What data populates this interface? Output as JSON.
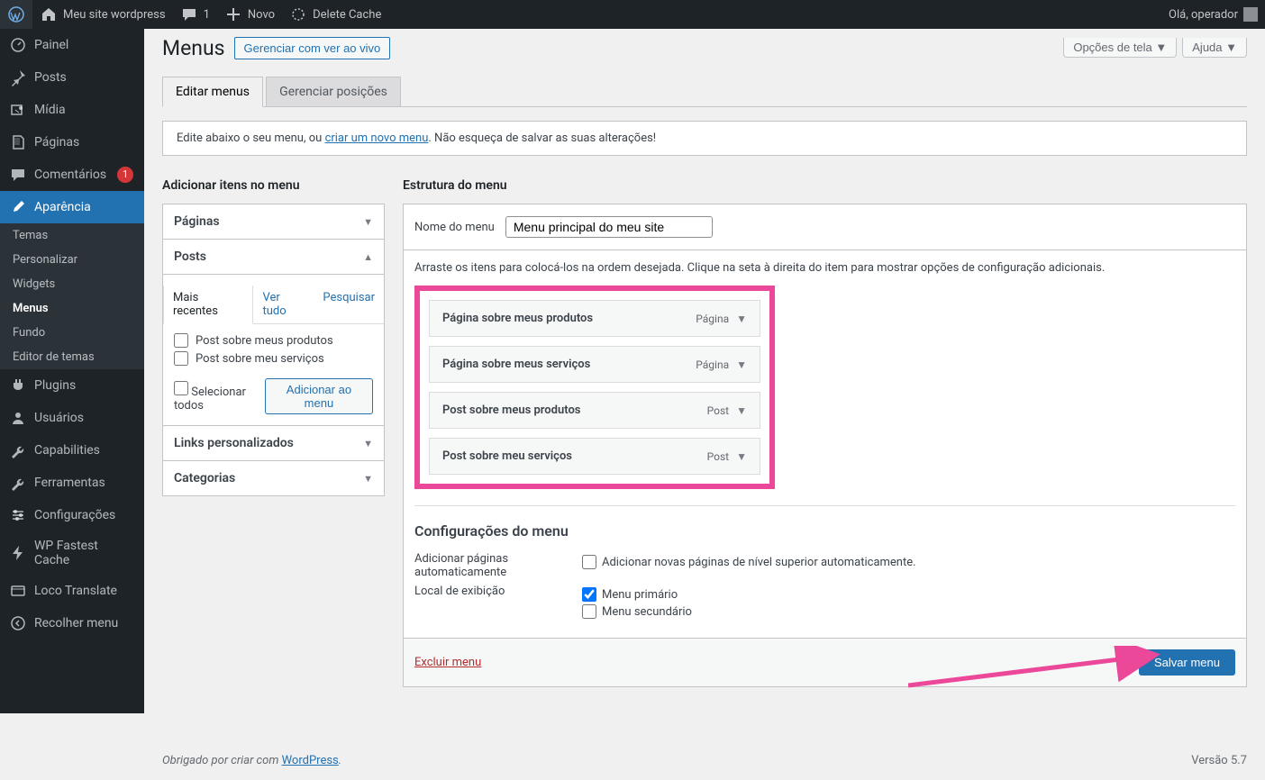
{
  "adminbar": {
    "site_title": "Meu site wordpress",
    "comments_count": "1",
    "new_label": "Novo",
    "delete_cache": "Delete Cache",
    "greeting": "Olá, operador"
  },
  "sidebar": {
    "items": [
      {
        "label": "Painel",
        "icon": "dashboard"
      },
      {
        "label": "Posts",
        "icon": "pin"
      },
      {
        "label": "Mídia",
        "icon": "media"
      },
      {
        "label": "Páginas",
        "icon": "pages"
      },
      {
        "label": "Comentários",
        "icon": "comment",
        "badge": "1"
      },
      {
        "label": "Aparência",
        "icon": "brush",
        "current": true,
        "submenu": [
          "Temas",
          "Personalizar",
          "Widgets",
          "Menus",
          "Fundo",
          "Editor de temas"
        ],
        "sub_current": "Menus"
      },
      {
        "label": "Plugins",
        "icon": "plugin"
      },
      {
        "label": "Usuários",
        "icon": "users"
      },
      {
        "label": "Capabilities",
        "icon": "wrench"
      },
      {
        "label": "Ferramentas",
        "icon": "wrench"
      },
      {
        "label": "Configurações",
        "icon": "sliders"
      },
      {
        "label": "WP Fastest Cache",
        "icon": "bolt"
      },
      {
        "label": "Loco Translate",
        "icon": "globe"
      },
      {
        "label": "Recolher menu",
        "icon": "collapse"
      }
    ]
  },
  "screen_opts": "Opções de tela",
  "help": "Ajuda",
  "page": {
    "title": "Menus",
    "live_action": "Gerenciar com ver ao vivo",
    "tabs": {
      "edit": "Editar menus",
      "locations": "Gerenciar posições"
    },
    "notice_pre": "Edite abaixo o seu menu, ou ",
    "notice_link": "criar um novo menu",
    "notice_post": ". Não esqueça de salvar as suas alterações!"
  },
  "add_box": {
    "heading": "Adicionar itens no menu",
    "sections": {
      "paginas": "Páginas",
      "posts": "Posts",
      "links": "Links personalizados",
      "categorias": "Categorias"
    },
    "subtabs": {
      "recent": "Mais recentes",
      "all": "Ver tudo",
      "search": "Pesquisar"
    },
    "post_items": [
      "Post sobre meus produtos",
      "Post sobre meu serviços"
    ],
    "select_all": "Selecionar todos",
    "add_button": "Adicionar ao menu"
  },
  "structure": {
    "heading": "Estrutura do menu",
    "name_label": "Nome do menu",
    "name_value": "Menu principal do meu site",
    "hint": "Arraste os itens para colocá-los na ordem desejada. Clique na seta à direita do item para mostrar opções de configuração adicionais.",
    "items": [
      {
        "title": "Página sobre meus produtos",
        "type": "Página"
      },
      {
        "title": "Página sobre meus serviços",
        "type": "Página"
      },
      {
        "title": "Post sobre meus produtos",
        "type": "Post"
      },
      {
        "title": "Post sobre meu serviços",
        "type": "Post"
      }
    ],
    "settings_heading": "Configurações do menu",
    "auto_add_label": "Adicionar páginas automaticamente",
    "auto_add_cb": "Adicionar novas páginas de nível superior automaticamente.",
    "location_label": "Local de exibição",
    "locations": [
      "Menu primário",
      "Menu secundário"
    ],
    "delete": "Excluir menu",
    "save": "Salvar menu"
  },
  "footer": {
    "thanks_pre": "Obrigado por criar com ",
    "thanks_link": "WordPress",
    "version": "Versão 5.7"
  }
}
